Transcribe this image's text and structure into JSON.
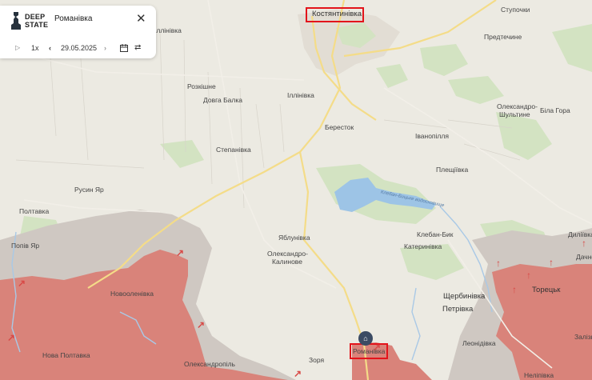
{
  "app": {
    "logo_line1": "DEEP",
    "logo_line2": "STATE",
    "place_name": "Романівка",
    "speed": "1x",
    "date": "29.05.2025"
  },
  "icons": [
    "deepstate-logo-icon",
    "close-icon",
    "play-icon",
    "chevron-left-icon",
    "chevron-right-icon",
    "calendar-icon",
    "compare-icon",
    "location-pin-icon",
    "direction-arrow-icon"
  ],
  "colors": {
    "occupied_zone": "#d9837a",
    "grey_zone": "#c9c3bd",
    "highlight": "#e3141b",
    "river": "#9dc4e6",
    "forest": "#cfe0bd"
  },
  "map_labels": {
    "kostiantynivka": "Костянтинівка",
    "stupochky": "Ступочки",
    "predtechyne": "Предтечине",
    "illinivka_top": "Іллінівка",
    "rozkishne": "Розкішне",
    "dovha_balka": "Довга Балка",
    "ilinivka": "Іллінівка",
    "oleksandro_shultyne_1": "Олександро-",
    "oleksandro_shultyne_2": "Шультине",
    "bila_hora": "Біла Гора",
    "berestok": "Бересток",
    "ivanopillia": "Іванопілля",
    "stepanivka": "Степанівка",
    "pleshchiivka": "Плещіївка",
    "kleban_byk_reservoir": "Клебан-Бицьке водосховище",
    "rusyn_yar": "Русин Яр",
    "poltavka": "Полтавка",
    "kleban_byk": "Клебан-Бик",
    "dyliivka": "Диліївка",
    "popiv_yar": "Попів Яр",
    "yablunivka": "Яблунівка",
    "katerynivka": "Катеринівка",
    "dachne": "Дачне",
    "oleksandro_kalynove_1": "Олександро-",
    "oleksandro_kalynove_2": "Калинове",
    "toretsk": "Торецьк",
    "novooleniivka": "Новооленівка",
    "shcherbynivka": "Щербинівка",
    "petrivka": "Петрівка",
    "nova_poltavka": "Нова Полтавка",
    "zoria": "Зоря",
    "leonidivka": "Леонідівка",
    "zalizne": "Залізне",
    "romanivka": "Романівка",
    "oleksandropil": "Олександропіль",
    "neliplivka": "Неліпівка"
  }
}
